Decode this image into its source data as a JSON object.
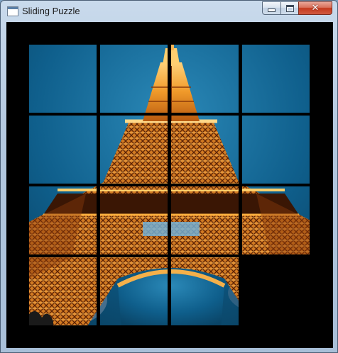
{
  "window": {
    "title": "Sliding Puzzle",
    "icon": "app-window-icon",
    "controls": {
      "minimize_icon": "minimize-icon",
      "maximize_icon": "maximize-icon",
      "close_icon": "close-icon"
    }
  },
  "puzzle": {
    "grid_size": 4,
    "image_subject": "Eiffel Tower at night, viewed from below",
    "tiles": [
      {
        "row": 0,
        "col": 0,
        "piece": 1
      },
      {
        "row": 0,
        "col": 1,
        "piece": 2
      },
      {
        "row": 0,
        "col": 2,
        "piece": 3
      },
      {
        "row": 0,
        "col": 3,
        "piece": 4
      },
      {
        "row": 1,
        "col": 0,
        "piece": 5
      },
      {
        "row": 1,
        "col": 1,
        "piece": 6
      },
      {
        "row": 1,
        "col": 2,
        "piece": 7
      },
      {
        "row": 1,
        "col": 3,
        "piece": 8
      },
      {
        "row": 2,
        "col": 0,
        "piece": 9
      },
      {
        "row": 2,
        "col": 1,
        "piece": 10
      },
      {
        "row": 2,
        "col": 2,
        "piece": 11
      },
      {
        "row": 2,
        "col": 3,
        "piece": 12
      },
      {
        "row": 3,
        "col": 0,
        "piece": 13
      },
      {
        "row": 3,
        "col": 1,
        "piece": 14
      },
      {
        "row": 3,
        "col": 2,
        "piece": 15
      }
    ],
    "empty": {
      "row": 3,
      "col": 3
    },
    "colors": {
      "sky": "#0f5f8c",
      "sky_light": "#2a86b5",
      "tower_glow": "#f0a030",
      "tower_dark": "#4a1c05",
      "background": "#000000"
    }
  }
}
